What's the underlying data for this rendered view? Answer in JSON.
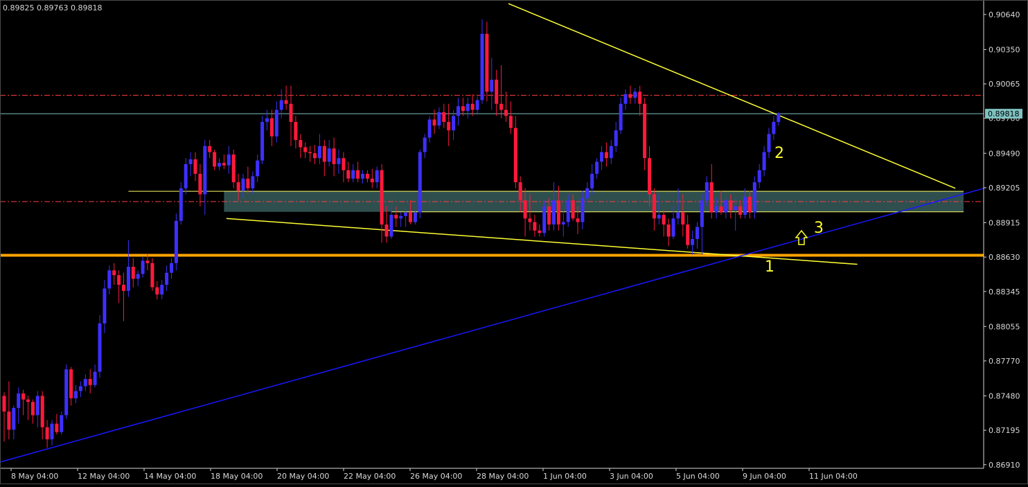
{
  "header": {
    "ohlc_text": "0.89825 0.89763 0.89818"
  },
  "price_label": "0.89818",
  "colors": {
    "background": "#000000",
    "axis": "#d9d9d9",
    "bull_candle": "#3d30ff",
    "bear_candle": "#ff1a3c",
    "wick": "#9a9a9a",
    "support_line": "#ffa400",
    "trend_yellow": "#ffff33",
    "trend_blue": "#1818ff",
    "zone_fill": "#2f4f4f",
    "zone_border": "#ffff66",
    "level_red": "#ff3c3c",
    "current_price_line": "#7fc3c3",
    "annotation": "#ffff33"
  },
  "chart_data": {
    "type": "candlestick",
    "symbol_shown_text": "0.89825 0.89763 0.89818",
    "y_ticks": [
      "0.90640",
      "0.90350",
      "0.90065",
      "0.89780",
      "0.89490",
      "0.89205",
      "0.88915",
      "0.88630",
      "0.88345",
      "0.88055",
      "0.87770",
      "0.87480",
      "0.87195",
      "0.86910"
    ],
    "x_ticks": [
      "8 May 04:00",
      "12 May 04:00",
      "14 May 04:00",
      "18 May 04:00",
      "20 May 04:00",
      "22 May 04:00",
      "26 May 04:00",
      "28 May 04:00",
      "1 Jun 04:00",
      "3 Jun 04:00",
      "5 Jun 04:00",
      "9 Jun 04:00",
      "11 Jun 04:00"
    ],
    "ylim": [
      0.8688,
      0.9076
    ],
    "current_price": 0.89818,
    "horizontal_levels": [
      {
        "kind": "support",
        "value": 0.88645
      },
      {
        "kind": "dashed-red",
        "value": 0.89971
      },
      {
        "kind": "dashed-red",
        "value": 0.8909
      }
    ],
    "zone": {
      "top": 0.89175,
      "bottom": 0.89005
    },
    "annotations": [
      "1",
      "2",
      "3"
    ],
    "candles": [
      {
        "o": 0.8748,
        "h": 0.8751,
        "l": 0.871,
        "c": 0.8735
      },
      {
        "o": 0.8735,
        "h": 0.876,
        "l": 0.8712,
        "c": 0.872
      },
      {
        "o": 0.872,
        "h": 0.874,
        "l": 0.8712,
        "c": 0.8738
      },
      {
        "o": 0.8738,
        "h": 0.8755,
        "l": 0.8725,
        "c": 0.875
      },
      {
        "o": 0.875,
        "h": 0.8753,
        "l": 0.8732,
        "c": 0.8745
      },
      {
        "o": 0.8745,
        "h": 0.8748,
        "l": 0.8728,
        "c": 0.8743
      },
      {
        "o": 0.8743,
        "h": 0.8745,
        "l": 0.8725,
        "c": 0.8732
      },
      {
        "o": 0.8732,
        "h": 0.8752,
        "l": 0.8722,
        "c": 0.8748
      },
      {
        "o": 0.8748,
        "h": 0.8752,
        "l": 0.8712,
        "c": 0.8722
      },
      {
        "o": 0.8722,
        "h": 0.8728,
        "l": 0.8705,
        "c": 0.8712
      },
      {
        "o": 0.8712,
        "h": 0.8728,
        "l": 0.8707,
        "c": 0.8725
      },
      {
        "o": 0.8725,
        "h": 0.8733,
        "l": 0.8716,
        "c": 0.8718
      },
      {
        "o": 0.8718,
        "h": 0.8735,
        "l": 0.8716,
        "c": 0.8732
      },
      {
        "o": 0.8732,
        "h": 0.8774,
        "l": 0.8729,
        "c": 0.877
      },
      {
        "o": 0.877,
        "h": 0.8772,
        "l": 0.874,
        "c": 0.8746
      },
      {
        "o": 0.8746,
        "h": 0.8757,
        "l": 0.8742,
        "c": 0.8752
      },
      {
        "o": 0.8752,
        "h": 0.876,
        "l": 0.8747,
        "c": 0.8756
      },
      {
        "o": 0.8756,
        "h": 0.8766,
        "l": 0.8752,
        "c": 0.8762
      },
      {
        "o": 0.8762,
        "h": 0.877,
        "l": 0.875,
        "c": 0.8757
      },
      {
        "o": 0.8757,
        "h": 0.8774,
        "l": 0.8755,
        "c": 0.8768
      },
      {
        "o": 0.8768,
        "h": 0.8815,
        "l": 0.8763,
        "c": 0.8808
      },
      {
        "o": 0.8808,
        "h": 0.8844,
        "l": 0.88,
        "c": 0.8837
      },
      {
        "o": 0.8837,
        "h": 0.8856,
        "l": 0.8832,
        "c": 0.8852
      },
      {
        "o": 0.8852,
        "h": 0.8858,
        "l": 0.884,
        "c": 0.8848
      },
      {
        "o": 0.8848,
        "h": 0.8852,
        "l": 0.8825,
        "c": 0.884
      },
      {
        "o": 0.884,
        "h": 0.885,
        "l": 0.881,
        "c": 0.8835
      },
      {
        "o": 0.8835,
        "h": 0.8877,
        "l": 0.883,
        "c": 0.8855
      },
      {
        "o": 0.8855,
        "h": 0.8862,
        "l": 0.8838,
        "c": 0.8845
      },
      {
        "o": 0.8845,
        "h": 0.8852,
        "l": 0.8839,
        "c": 0.8849
      },
      {
        "o": 0.8849,
        "h": 0.8863,
        "l": 0.8846,
        "c": 0.886
      },
      {
        "o": 0.886,
        "h": 0.8866,
        "l": 0.8852,
        "c": 0.8858
      },
      {
        "o": 0.8858,
        "h": 0.8862,
        "l": 0.8835,
        "c": 0.8838
      },
      {
        "o": 0.8838,
        "h": 0.8843,
        "l": 0.8828,
        "c": 0.8832
      },
      {
        "o": 0.8832,
        "h": 0.8844,
        "l": 0.8828,
        "c": 0.884
      },
      {
        "o": 0.884,
        "h": 0.8856,
        "l": 0.8835,
        "c": 0.885
      },
      {
        "o": 0.885,
        "h": 0.8862,
        "l": 0.8845,
        "c": 0.8858
      },
      {
        "o": 0.8858,
        "h": 0.8899,
        "l": 0.8852,
        "c": 0.8893
      },
      {
        "o": 0.8893,
        "h": 0.8925,
        "l": 0.889,
        "c": 0.892
      },
      {
        "o": 0.892,
        "h": 0.8945,
        "l": 0.8915,
        "c": 0.894
      },
      {
        "o": 0.894,
        "h": 0.895,
        "l": 0.893,
        "c": 0.8944
      },
      {
        "o": 0.8944,
        "h": 0.895,
        "l": 0.8926,
        "c": 0.8932
      },
      {
        "o": 0.8932,
        "h": 0.894,
        "l": 0.8905,
        "c": 0.8915
      },
      {
        "o": 0.8915,
        "h": 0.896,
        "l": 0.8898,
        "c": 0.8955
      },
      {
        "o": 0.8955,
        "h": 0.896,
        "l": 0.8945,
        "c": 0.895
      },
      {
        "o": 0.895,
        "h": 0.8952,
        "l": 0.8935,
        "c": 0.8938
      },
      {
        "o": 0.8938,
        "h": 0.8945,
        "l": 0.8935,
        "c": 0.8941
      },
      {
        "o": 0.8941,
        "h": 0.8948,
        "l": 0.8936,
        "c": 0.8939
      },
      {
        "o": 0.8939,
        "h": 0.8955,
        "l": 0.8932,
        "c": 0.8948
      },
      {
        "o": 0.8948,
        "h": 0.8952,
        "l": 0.892,
        "c": 0.8925
      },
      {
        "o": 0.8925,
        "h": 0.8932,
        "l": 0.891,
        "c": 0.8918
      },
      {
        "o": 0.8918,
        "h": 0.8932,
        "l": 0.8912,
        "c": 0.8928
      },
      {
        "o": 0.8928,
        "h": 0.8938,
        "l": 0.8916,
        "c": 0.892
      },
      {
        "o": 0.892,
        "h": 0.8934,
        "l": 0.8916,
        "c": 0.893
      },
      {
        "o": 0.893,
        "h": 0.8948,
        "l": 0.8925,
        "c": 0.8943
      },
      {
        "o": 0.8943,
        "h": 0.898,
        "l": 0.894,
        "c": 0.8975
      },
      {
        "o": 0.8975,
        "h": 0.8985,
        "l": 0.8968,
        "c": 0.8978
      },
      {
        "o": 0.8978,
        "h": 0.8985,
        "l": 0.8955,
        "c": 0.8963
      },
      {
        "o": 0.8963,
        "h": 0.8992,
        "l": 0.8958,
        "c": 0.8985
      },
      {
        "o": 0.8985,
        "h": 0.9002,
        "l": 0.8978,
        "c": 0.8993
      },
      {
        "o": 0.8993,
        "h": 0.9005,
        "l": 0.8985,
        "c": 0.899
      },
      {
        "o": 0.899,
        "h": 0.9005,
        "l": 0.8955,
        "c": 0.8975
      },
      {
        "o": 0.8975,
        "h": 0.898,
        "l": 0.8953,
        "c": 0.896
      },
      {
        "o": 0.896,
        "h": 0.8965,
        "l": 0.8945,
        "c": 0.8954
      },
      {
        "o": 0.8954,
        "h": 0.8958,
        "l": 0.8945,
        "c": 0.895
      },
      {
        "o": 0.895,
        "h": 0.8955,
        "l": 0.8942,
        "c": 0.8949
      },
      {
        "o": 0.8949,
        "h": 0.8956,
        "l": 0.894,
        "c": 0.8945
      },
      {
        "o": 0.8945,
        "h": 0.8965,
        "l": 0.894,
        "c": 0.8955
      },
      {
        "o": 0.8955,
        "h": 0.896,
        "l": 0.893,
        "c": 0.8942
      },
      {
        "o": 0.8942,
        "h": 0.896,
        "l": 0.8938,
        "c": 0.8953
      },
      {
        "o": 0.8953,
        "h": 0.8962,
        "l": 0.893,
        "c": 0.894
      },
      {
        "o": 0.894,
        "h": 0.8952,
        "l": 0.8932,
        "c": 0.8945
      },
      {
        "o": 0.8945,
        "h": 0.895,
        "l": 0.8925,
        "c": 0.8935
      },
      {
        "o": 0.8935,
        "h": 0.8942,
        "l": 0.8925,
        "c": 0.8928
      },
      {
        "o": 0.8928,
        "h": 0.894,
        "l": 0.8925,
        "c": 0.8935
      },
      {
        "o": 0.8935,
        "h": 0.8942,
        "l": 0.8925,
        "c": 0.8928
      },
      {
        "o": 0.8928,
        "h": 0.8935,
        "l": 0.8924,
        "c": 0.8932
      },
      {
        "o": 0.8932,
        "h": 0.8935,
        "l": 0.8925,
        "c": 0.8928
      },
      {
        "o": 0.8928,
        "h": 0.8936,
        "l": 0.892,
        "c": 0.8925
      },
      {
        "o": 0.8925,
        "h": 0.8938,
        "l": 0.892,
        "c": 0.8935
      },
      {
        "o": 0.8935,
        "h": 0.894,
        "l": 0.8875,
        "c": 0.889
      },
      {
        "o": 0.889,
        "h": 0.8905,
        "l": 0.8875,
        "c": 0.888
      },
      {
        "o": 0.888,
        "h": 0.8905,
        "l": 0.8878,
        "c": 0.8898
      },
      {
        "o": 0.8898,
        "h": 0.8905,
        "l": 0.8888,
        "c": 0.8895
      },
      {
        "o": 0.8895,
        "h": 0.89,
        "l": 0.8888,
        "c": 0.8897
      },
      {
        "o": 0.8897,
        "h": 0.8905,
        "l": 0.8888,
        "c": 0.89
      },
      {
        "o": 0.89,
        "h": 0.891,
        "l": 0.889,
        "c": 0.8892
      },
      {
        "o": 0.8892,
        "h": 0.8902,
        "l": 0.889,
        "c": 0.89
      },
      {
        "o": 0.89,
        "h": 0.8952,
        "l": 0.8895,
        "c": 0.895
      },
      {
        "o": 0.895,
        "h": 0.8965,
        "l": 0.8945,
        "c": 0.8962
      },
      {
        "o": 0.8962,
        "h": 0.898,
        "l": 0.8958,
        "c": 0.8977
      },
      {
        "o": 0.8977,
        "h": 0.8985,
        "l": 0.8965,
        "c": 0.8972
      },
      {
        "o": 0.8972,
        "h": 0.8987,
        "l": 0.8969,
        "c": 0.8983
      },
      {
        "o": 0.8983,
        "h": 0.899,
        "l": 0.897,
        "c": 0.8975
      },
      {
        "o": 0.8975,
        "h": 0.899,
        "l": 0.8955,
        "c": 0.8968
      },
      {
        "o": 0.8968,
        "h": 0.8985,
        "l": 0.896,
        "c": 0.898
      },
      {
        "o": 0.898,
        "h": 0.8995,
        "l": 0.8972,
        "c": 0.8988
      },
      {
        "o": 0.8988,
        "h": 0.8995,
        "l": 0.898,
        "c": 0.8984
      },
      {
        "o": 0.8984,
        "h": 0.8995,
        "l": 0.8978,
        "c": 0.899
      },
      {
        "o": 0.899,
        "h": 0.8998,
        "l": 0.898,
        "c": 0.8985
      },
      {
        "o": 0.8985,
        "h": 0.8996,
        "l": 0.8982,
        "c": 0.8993
      },
      {
        "o": 0.8993,
        "h": 0.906,
        "l": 0.899,
        "c": 0.9048
      },
      {
        "o": 0.9048,
        "h": 0.9058,
        "l": 0.8992,
        "c": 0.9
      },
      {
        "o": 0.9,
        "h": 0.9028,
        "l": 0.8985,
        "c": 0.901
      },
      {
        "o": 0.901,
        "h": 0.9018,
        "l": 0.898,
        "c": 0.899
      },
      {
        "o": 0.899,
        "h": 0.9022,
        "l": 0.8978,
        "c": 0.8985
      },
      {
        "o": 0.8985,
        "h": 0.9,
        "l": 0.8975,
        "c": 0.898
      },
      {
        "o": 0.898,
        "h": 0.8992,
        "l": 0.8965,
        "c": 0.897
      },
      {
        "o": 0.897,
        "h": 0.898,
        "l": 0.892,
        "c": 0.8925
      },
      {
        "o": 0.8925,
        "h": 0.893,
        "l": 0.89,
        "c": 0.891
      },
      {
        "o": 0.891,
        "h": 0.892,
        "l": 0.888,
        "c": 0.8895
      },
      {
        "o": 0.8895,
        "h": 0.8915,
        "l": 0.8885,
        "c": 0.8892
      },
      {
        "o": 0.8892,
        "h": 0.8898,
        "l": 0.888,
        "c": 0.8885
      },
      {
        "o": 0.8885,
        "h": 0.889,
        "l": 0.888,
        "c": 0.8883
      },
      {
        "o": 0.8883,
        "h": 0.891,
        "l": 0.888,
        "c": 0.8905
      },
      {
        "o": 0.8905,
        "h": 0.8912,
        "l": 0.8885,
        "c": 0.889
      },
      {
        "o": 0.889,
        "h": 0.8925,
        "l": 0.8885,
        "c": 0.891
      },
      {
        "o": 0.891,
        "h": 0.8922,
        "l": 0.8885,
        "c": 0.889
      },
      {
        "o": 0.889,
        "h": 0.8902,
        "l": 0.888,
        "c": 0.8892
      },
      {
        "o": 0.8892,
        "h": 0.8915,
        "l": 0.8888,
        "c": 0.891
      },
      {
        "o": 0.891,
        "h": 0.8915,
        "l": 0.8893,
        "c": 0.8895
      },
      {
        "o": 0.8895,
        "h": 0.8905,
        "l": 0.8882,
        "c": 0.8892
      },
      {
        "o": 0.8892,
        "h": 0.8918,
        "l": 0.8886,
        "c": 0.8912
      },
      {
        "o": 0.8912,
        "h": 0.8925,
        "l": 0.8908,
        "c": 0.892
      },
      {
        "o": 0.892,
        "h": 0.894,
        "l": 0.8915,
        "c": 0.8932
      },
      {
        "o": 0.8932,
        "h": 0.8945,
        "l": 0.8928,
        "c": 0.8942
      },
      {
        "o": 0.8942,
        "h": 0.8955,
        "l": 0.8935,
        "c": 0.895
      },
      {
        "o": 0.895,
        "h": 0.8958,
        "l": 0.8938,
        "c": 0.8945
      },
      {
        "o": 0.8945,
        "h": 0.896,
        "l": 0.894,
        "c": 0.8955
      },
      {
        "o": 0.8955,
        "h": 0.8975,
        "l": 0.895,
        "c": 0.8968
      },
      {
        "o": 0.8968,
        "h": 0.8995,
        "l": 0.8965,
        "c": 0.899
      },
      {
        "o": 0.899,
        "h": 0.9002,
        "l": 0.8985,
        "c": 0.8998
      },
      {
        "o": 0.8998,
        "h": 0.9005,
        "l": 0.899,
        "c": 0.8995
      },
      {
        "o": 0.8995,
        "h": 0.9003,
        "l": 0.899,
        "c": 0.9
      },
      {
        "o": 0.9,
        "h": 0.9005,
        "l": 0.898,
        "c": 0.899
      },
      {
        "o": 0.899,
        "h": 0.8995,
        "l": 0.8935,
        "c": 0.8945
      },
      {
        "o": 0.8945,
        "h": 0.8955,
        "l": 0.8905,
        "c": 0.8915
      },
      {
        "o": 0.8915,
        "h": 0.892,
        "l": 0.8885,
        "c": 0.8895
      },
      {
        "o": 0.8895,
        "h": 0.8915,
        "l": 0.889,
        "c": 0.8898
      },
      {
        "o": 0.8898,
        "h": 0.8902,
        "l": 0.888,
        "c": 0.889
      },
      {
        "o": 0.889,
        "h": 0.8895,
        "l": 0.8872,
        "c": 0.888
      },
      {
        "o": 0.888,
        "h": 0.8905,
        "l": 0.8878,
        "c": 0.8895
      },
      {
        "o": 0.8895,
        "h": 0.892,
        "l": 0.889,
        "c": 0.89
      },
      {
        "o": 0.89,
        "h": 0.8915,
        "l": 0.888,
        "c": 0.889
      },
      {
        "o": 0.889,
        "h": 0.8898,
        "l": 0.887,
        "c": 0.8873
      },
      {
        "o": 0.8873,
        "h": 0.8885,
        "l": 0.8865,
        "c": 0.8878
      },
      {
        "o": 0.8878,
        "h": 0.8892,
        "l": 0.887,
        "c": 0.8888
      },
      {
        "o": 0.8888,
        "h": 0.8915,
        "l": 0.8865,
        "c": 0.891
      },
      {
        "o": 0.891,
        "h": 0.893,
        "l": 0.8905,
        "c": 0.8925
      },
      {
        "o": 0.8925,
        "h": 0.894,
        "l": 0.8895,
        "c": 0.89
      },
      {
        "o": 0.89,
        "h": 0.8912,
        "l": 0.8895,
        "c": 0.8905
      },
      {
        "o": 0.8905,
        "h": 0.8918,
        "l": 0.8898,
        "c": 0.89
      },
      {
        "o": 0.89,
        "h": 0.8912,
        "l": 0.8895,
        "c": 0.891
      },
      {
        "o": 0.891,
        "h": 0.8915,
        "l": 0.8895,
        "c": 0.8902
      },
      {
        "o": 0.8902,
        "h": 0.8912,
        "l": 0.8885,
        "c": 0.8905
      },
      {
        "o": 0.8905,
        "h": 0.891,
        "l": 0.8895,
        "c": 0.8898
      },
      {
        "o": 0.8898,
        "h": 0.892,
        "l": 0.8895,
        "c": 0.8913
      },
      {
        "o": 0.8913,
        "h": 0.8918,
        "l": 0.8895,
        "c": 0.89
      },
      {
        "o": 0.89,
        "h": 0.893,
        "l": 0.8895,
        "c": 0.8925
      },
      {
        "o": 0.8925,
        "h": 0.894,
        "l": 0.892,
        "c": 0.8935
      },
      {
        "o": 0.8935,
        "h": 0.8955,
        "l": 0.893,
        "c": 0.895
      },
      {
        "o": 0.895,
        "h": 0.897,
        "l": 0.8945,
        "c": 0.8965
      },
      {
        "o": 0.8965,
        "h": 0.898,
        "l": 0.896,
        "c": 0.8975
      },
      {
        "o": 0.8975,
        "h": 0.8983,
        "l": 0.8972,
        "c": 0.8982
      }
    ]
  }
}
